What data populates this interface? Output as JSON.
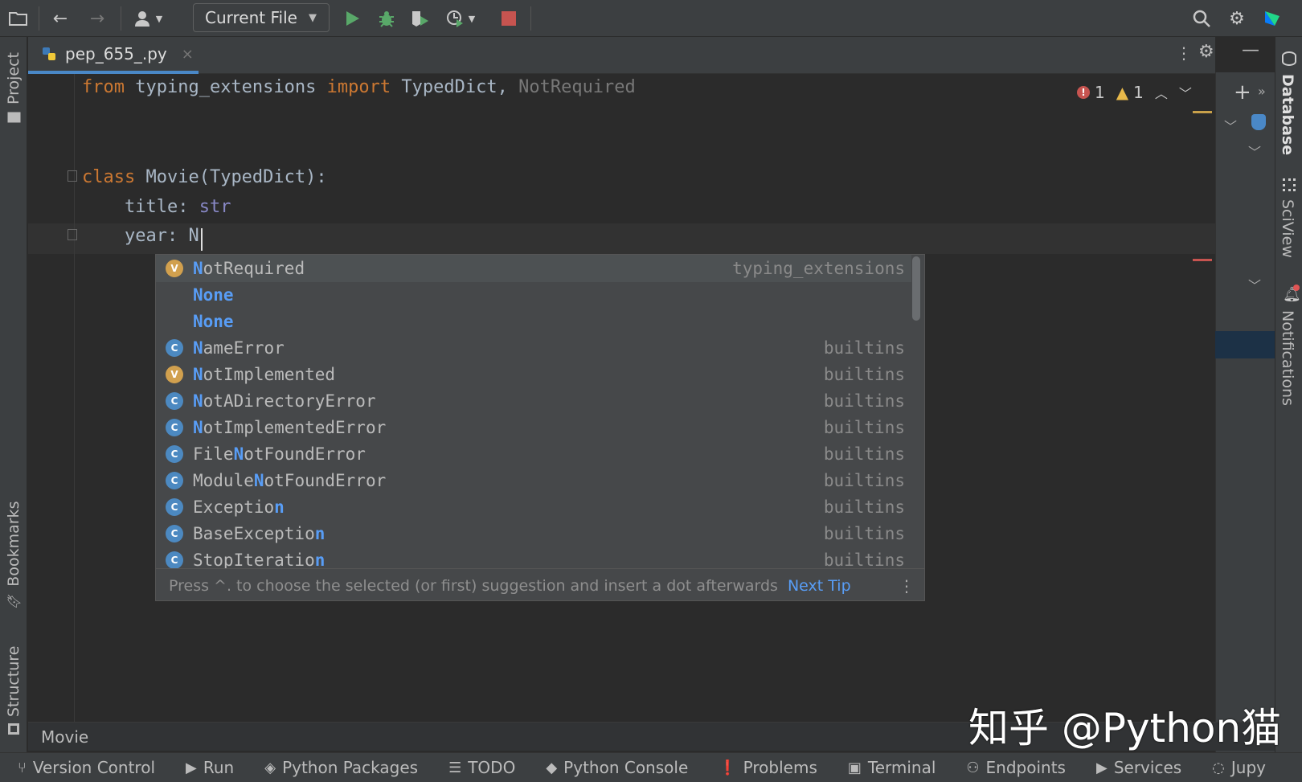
{
  "toolbar": {
    "run_config": "Current File"
  },
  "tab": {
    "filename": "pep_655_.py",
    "close": "×"
  },
  "left_strip": {
    "project": "Project",
    "bookmarks": "Bookmarks",
    "structure": "Structure"
  },
  "right_strip": {
    "database": "Database",
    "sciview": "SciView",
    "notifications": "Notifications"
  },
  "code": {
    "line1": {
      "from": "from",
      "module": " typing_extensions ",
      "import": "import",
      "names": " TypedDict, ",
      "unused": "NotRequired"
    },
    "line4": {
      "class": "class",
      "rest": " Movie(TypedDict):"
    },
    "line5": {
      "field": "    title: ",
      "type": "str"
    },
    "line6": {
      "field": "    year: ",
      "typed": "N"
    }
  },
  "inspections": {
    "errors": "1",
    "warnings": "1"
  },
  "completion": {
    "items": [
      {
        "icon": "V",
        "kind": "v",
        "match": "N",
        "rest": "otRequired",
        "source": "typing_extensions"
      },
      {
        "icon": "",
        "kind": "none",
        "match": "None",
        "rest": "",
        "source": ""
      },
      {
        "icon": "",
        "kind": "none",
        "match": "None",
        "rest": "",
        "source": ""
      },
      {
        "icon": "C",
        "kind": "c",
        "match": "N",
        "rest": "ameError",
        "source": "builtins"
      },
      {
        "icon": "V",
        "kind": "v",
        "match": "N",
        "rest": "otImplemented",
        "source": "builtins"
      },
      {
        "icon": "C",
        "kind": "c",
        "match": "N",
        "rest": "otADirectoryError",
        "source": "builtins"
      },
      {
        "icon": "C",
        "kind": "c",
        "match": "N",
        "rest": "otImplementedError",
        "source": "builtins"
      },
      {
        "icon": "C",
        "kind": "c",
        "prefix": "File",
        "match": "N",
        "rest": "otFoundError",
        "source": "builtins"
      },
      {
        "icon": "C",
        "kind": "c",
        "prefix": "Module",
        "match": "N",
        "rest": "otFoundError",
        "source": "builtins"
      },
      {
        "icon": "C",
        "kind": "c",
        "prefix": "Exceptio",
        "match": "n",
        "rest": "",
        "source": "builtins"
      },
      {
        "icon": "C",
        "kind": "c",
        "prefix": "BaseExceptio",
        "match": "n",
        "rest": "",
        "source": "builtins"
      },
      {
        "icon": "C",
        "kind": "c",
        "prefix": "StopIteratio",
        "match": "n",
        "rest": "",
        "source": "builtins"
      }
    ],
    "footer_text": "Press ^. to choose the selected (or first) suggestion and insert a dot afterwards",
    "footer_link": "Next Tip"
  },
  "breadcrumb": "Movie",
  "bottom_tabs": [
    "Version Control",
    "Run",
    "Python Packages",
    "TODO",
    "Python Console",
    "Problems",
    "Terminal",
    "Endpoints",
    "Services",
    "Jupy"
  ],
  "watermark": "知乎 @Python猫",
  "colors": {
    "accent": "#4a88c7",
    "keyword": "#cc7832",
    "match": "#589df6",
    "error": "#c75450",
    "warning": "#e8b94a"
  }
}
